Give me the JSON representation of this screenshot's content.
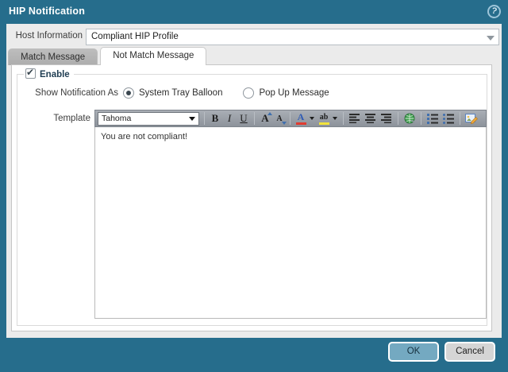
{
  "window": {
    "title": "HIP Notification"
  },
  "icons": {
    "help": "?",
    "check": "✔"
  },
  "colors": {
    "frame": "#266d8c",
    "accent_button": "#74a9c1",
    "toolbar": "#989ea6",
    "font_color_bar": "#e03c31",
    "highlight_bar": "#f2e33c"
  },
  "host_info": {
    "label": "Host Information",
    "value": "Compliant HIP Profile"
  },
  "tabs": [
    {
      "label": "Match Message",
      "active": false
    },
    {
      "label": "Not Match Message",
      "active": true
    }
  ],
  "enable": {
    "label": "Enable",
    "checked": true
  },
  "notification": {
    "label": "Show Notification As",
    "options": [
      {
        "label": "System Tray Balloon",
        "selected": true
      },
      {
        "label": "Pop Up Message",
        "selected": false
      }
    ]
  },
  "template": {
    "label": "Template",
    "font_name": "Tahoma",
    "toolbar": {
      "bold": "B",
      "italic": "I",
      "underline": "U",
      "grow_font": "A",
      "shrink_font": "A",
      "font_color": "A",
      "highlight": "ab"
    },
    "content": "You are not compliant!"
  },
  "footer": {
    "ok": "OK",
    "cancel": "Cancel"
  }
}
